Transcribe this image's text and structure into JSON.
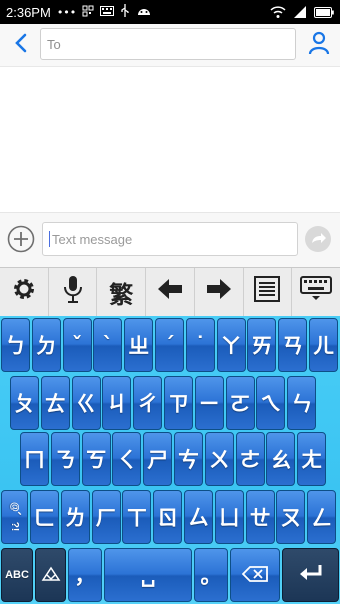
{
  "status_bar": {
    "time": "2:36PM",
    "dots": "•••"
  },
  "header": {
    "to_placeholder": "To",
    "back_icon": "chevron-left-icon",
    "contact_icon": "person-icon"
  },
  "compose": {
    "message_placeholder": "Text message",
    "attach_icon": "plus-circle-icon",
    "send_icon": "send-arrow-icon"
  },
  "toolbar": {
    "items": [
      {
        "name": "settings-gear-icon",
        "label": ""
      },
      {
        "name": "microphone-icon",
        "label": ""
      },
      {
        "name": "traditional-char-button",
        "label": "繁"
      },
      {
        "name": "arrow-left-icon",
        "label": ""
      },
      {
        "name": "arrow-right-icon",
        "label": ""
      },
      {
        "name": "list-icon",
        "label": ""
      },
      {
        "name": "keyboard-hide-icon",
        "label": ""
      }
    ]
  },
  "keyboard": {
    "row1": [
      "ㄅ",
      "ㄉ",
      "ˇ",
      "ˋ",
      "ㄓ",
      "ˊ",
      "˙",
      "ㄚ",
      "ㄞ",
      "ㄢ",
      "ㄦ"
    ],
    "row2": [
      "ㄆ",
      "ㄊ",
      "ㄍ",
      "ㄐ",
      "ㄔ",
      "ㄗ",
      "ㄧ",
      "ㄛ",
      "ㄟ",
      "ㄣ"
    ],
    "row3": [
      "ㄇ",
      "ㄋ",
      "ㄎ",
      "ㄑ",
      "ㄕ",
      "ㄘ",
      "ㄨ",
      "ㄜ",
      "ㄠ",
      "ㄤ"
    ],
    "row4_symbol": "@、?!",
    "row4": [
      "ㄈ",
      "ㄌ",
      "ㄏ",
      "ㄒ",
      "ㄖ",
      "ㄙ",
      "ㄩ",
      "ㄝ",
      "ㄡ",
      "ㄥ"
    ],
    "row5": {
      "abc": "ABC",
      "comma": "，",
      "space": "␣",
      "period": "。"
    },
    "colors": {
      "key_top": "#4f95ea",
      "key_bottom": "#1b5cba",
      "background": "#3bc4f2"
    }
  }
}
